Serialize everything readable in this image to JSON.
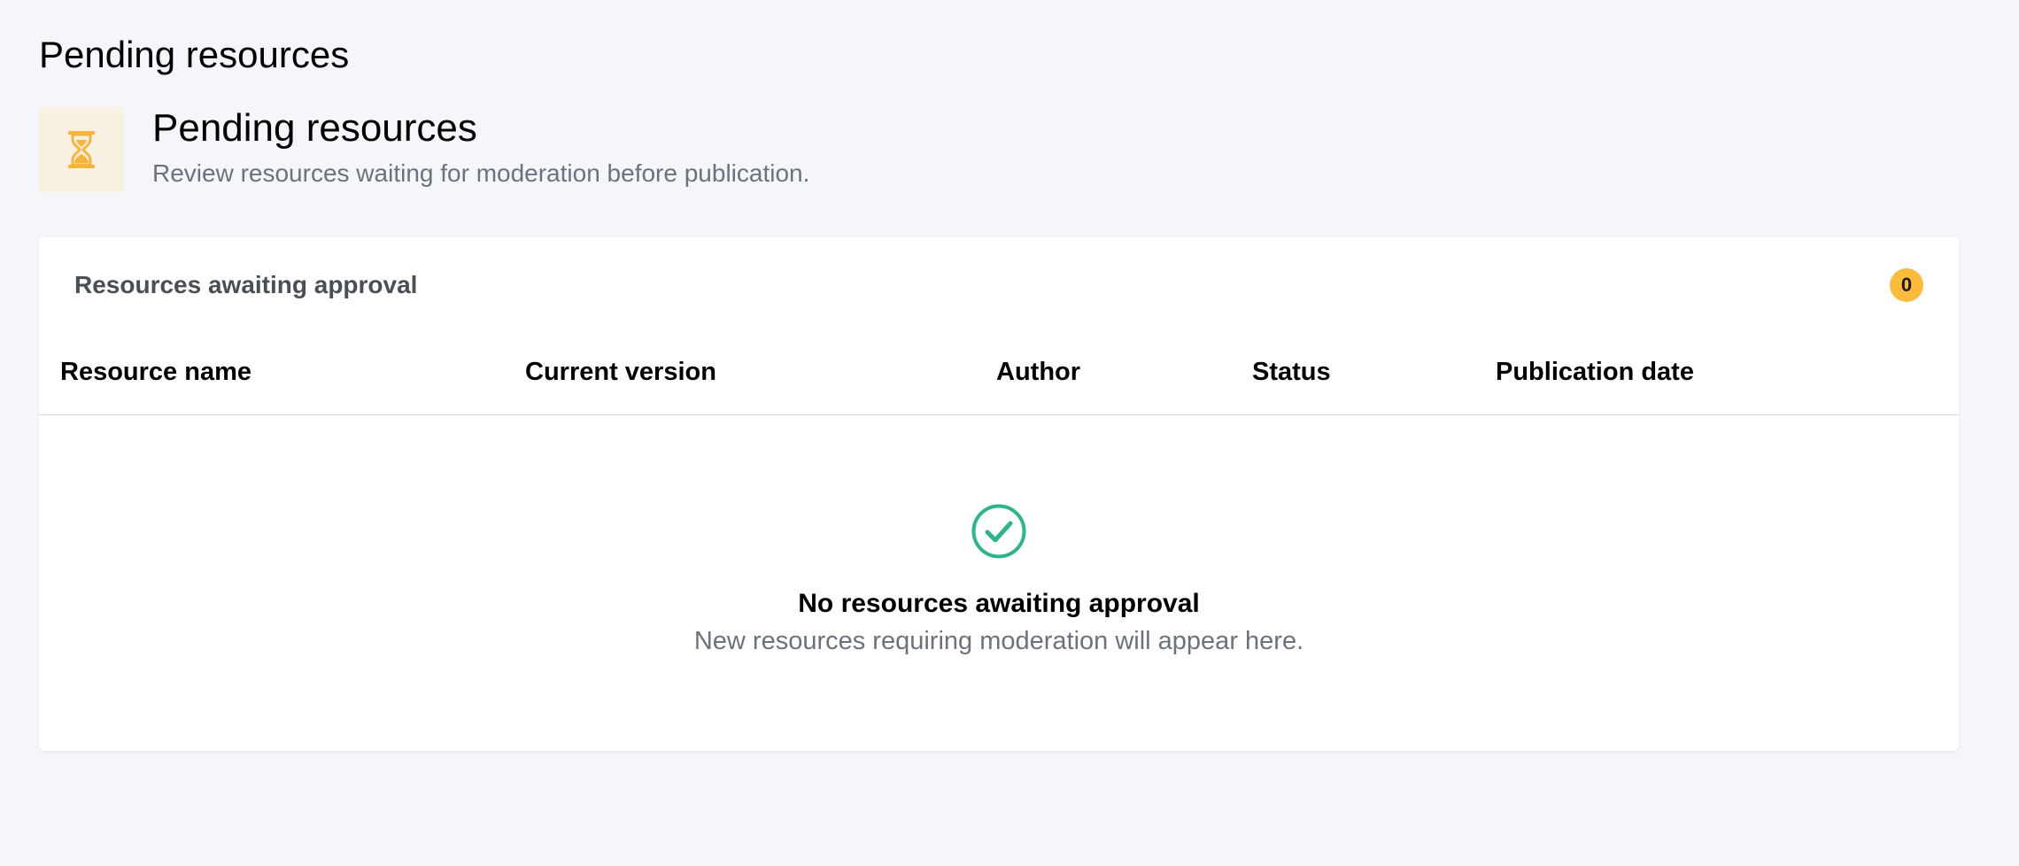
{
  "page": {
    "title": "Pending resources"
  },
  "hero": {
    "icon": "hourglass-icon",
    "title": "Pending resources",
    "subtitle": "Review resources waiting for moderation before publication."
  },
  "card": {
    "title": "Resources awaiting approval",
    "count": "0",
    "columns": [
      "Resource name",
      "Current version",
      "Author",
      "Status",
      "Publication date"
    ],
    "rows": [],
    "empty_state": {
      "icon": "check-circle-icon",
      "title": "No resources awaiting approval",
      "subtitle": "New resources requiring moderation will appear here."
    }
  },
  "colors": {
    "background": "#f5f6fa",
    "accent": "#fbbc3b",
    "success": "#2bb58a",
    "muted_text": "#6c727c"
  }
}
